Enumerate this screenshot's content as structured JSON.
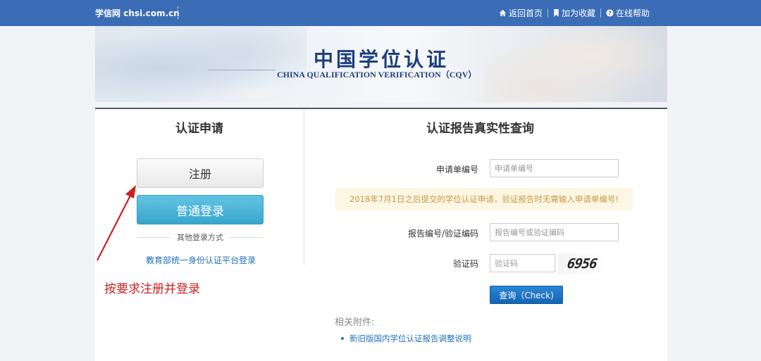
{
  "topbar": {
    "brand": "学信网 chsi.com.cn",
    "links": [
      {
        "label": "返回首页",
        "icon": "home-icon"
      },
      {
        "label": "加为收藏",
        "icon": "bookmark-icon"
      },
      {
        "label": "在线帮助",
        "icon": "help-icon"
      }
    ]
  },
  "banner": {
    "title": "中国学位认证",
    "subtitle": "CHINA QUALIFICATION VERIFICATION（CQV）"
  },
  "left_panel": {
    "title": "认证申请",
    "register_label": "注册",
    "login_label": "普通登录",
    "other_login": "其他登录方式",
    "moe_link": "教育部统一身份认证平台登录",
    "annotation": "按要求注册并登录"
  },
  "right_panel": {
    "title": "认证报告真实性查询",
    "app_no": {
      "label": "申请单编号",
      "placeholder": "申请单编号"
    },
    "notice": "2018年7月1日之后提交的学位认证申请，验证报告时无需输入申请单编号!",
    "report_no": {
      "label": "报告编号/验证编码",
      "placeholder": "报告编号或验证编码"
    },
    "captcha": {
      "label": "验证码",
      "placeholder": "验证码",
      "code": "6956"
    },
    "check_button": "查询（Check)",
    "attachments_title": "相关附件:",
    "attachments": [
      "新旧版国内学位认证报告调整说明"
    ]
  },
  "colors": {
    "topbar": "#3a6db5",
    "login_button": "#39a5cc",
    "check_button": "#1565b4",
    "annotation": "#d11f1f",
    "link": "#1f6fb5",
    "notice_bg": "#fdf6e3"
  }
}
